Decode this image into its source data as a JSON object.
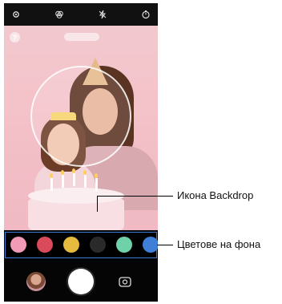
{
  "top_bar": {
    "icons": [
      "settings-icon",
      "filter-icon",
      "flash-off-icon",
      "timer-icon"
    ]
  },
  "preview": {
    "help_label": "?",
    "mode_icons": [
      "shape-mode-icon",
      "backdrop-icon"
    ]
  },
  "palette": {
    "colors": [
      "#f29bb6",
      "#d94a5a",
      "#e6b93f",
      "#2a2a2a",
      "#6fd1a8",
      "#3f7fd8"
    ]
  },
  "callouts": {
    "backdrop_icon": "Икона Backdrop",
    "background_colors": "Цветове на фона"
  }
}
